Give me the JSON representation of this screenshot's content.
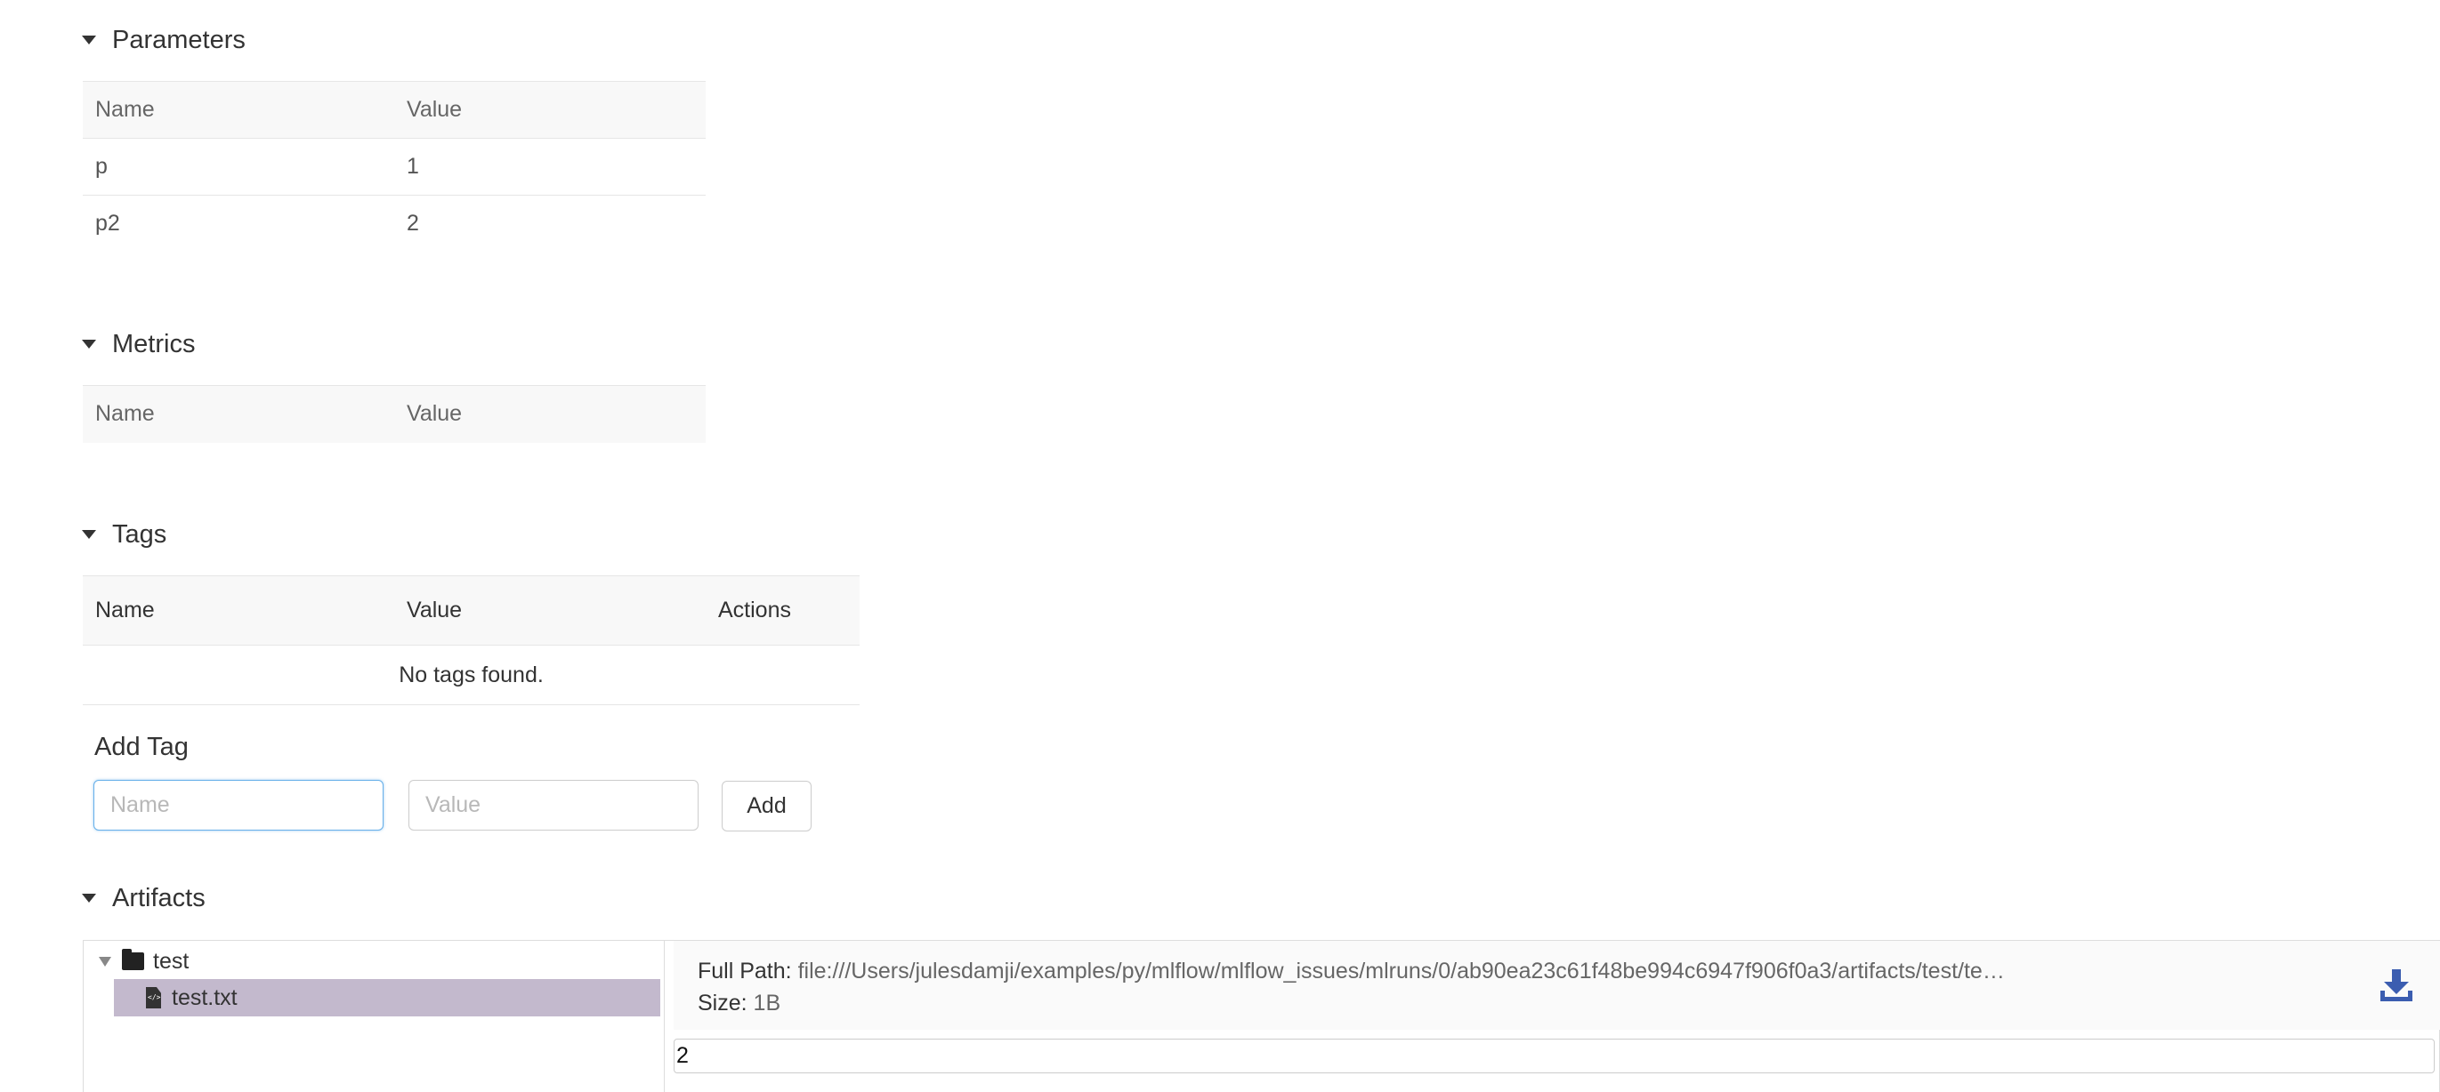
{
  "parameters": {
    "title": "Parameters",
    "columns": [
      "Name",
      "Value"
    ],
    "rows": [
      {
        "name": "p",
        "value": "1"
      },
      {
        "name": "p2",
        "value": "2"
      }
    ]
  },
  "metrics": {
    "title": "Metrics",
    "columns": [
      "Name",
      "Value"
    ]
  },
  "tags": {
    "title": "Tags",
    "columns": [
      "Name",
      "Value",
      "Actions"
    ],
    "empty_message": "No tags found."
  },
  "add_tag": {
    "label": "Add Tag",
    "name_placeholder": "Name",
    "value_placeholder": "Value",
    "button_label": "Add"
  },
  "artifacts": {
    "title": "Artifacts",
    "tree": {
      "folder": "test",
      "file": "test.txt"
    },
    "preview": {
      "full_path_label": "Full Path:",
      "full_path": "file:///Users/julesdamji/examples/py/mlflow/mlflow_issues/mlruns/0/ab90ea23c61f48be994c6947f906f0a3/artifacts/test/te…",
      "size_label": "Size:",
      "size": "1B",
      "content": "2"
    }
  },
  "colors": {
    "accent": "#3b5db0",
    "selected_row": "#c3b9cd",
    "focus_border": "#66afe9"
  },
  "icons": [
    "caret-down-icon",
    "folder-icon",
    "file-code-icon",
    "download-icon"
  ]
}
